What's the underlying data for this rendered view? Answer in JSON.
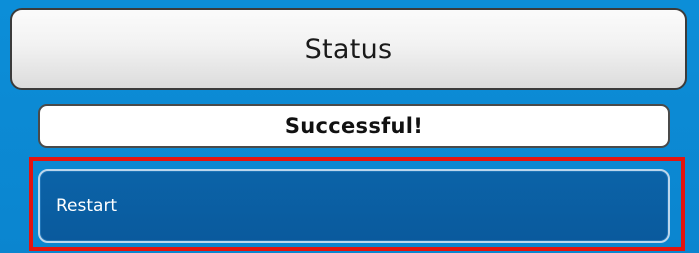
{
  "header": {
    "title": "Status"
  },
  "status": {
    "message": "Successful!"
  },
  "actions": {
    "restart_label": "Restart"
  },
  "colors": {
    "background": "#0e8fd6",
    "button_selected": "#0a5fa3",
    "highlight": "#e3140f"
  }
}
